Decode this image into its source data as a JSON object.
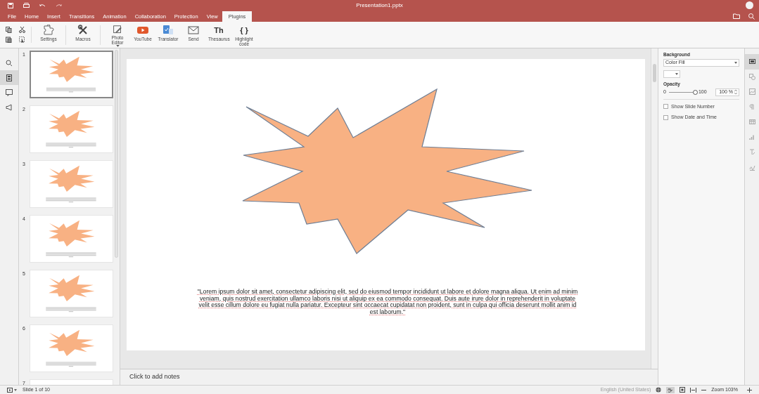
{
  "window": {
    "title": "Presentation1.pptx"
  },
  "menu_tabs": [
    {
      "label": "File",
      "selected": false
    },
    {
      "label": "Home",
      "selected": false
    },
    {
      "label": "Insert",
      "selected": false
    },
    {
      "label": "Transitions",
      "selected": false
    },
    {
      "label": "Animation",
      "selected": false
    },
    {
      "label": "Collaboration",
      "selected": false
    },
    {
      "label": "Protection",
      "selected": false
    },
    {
      "label": "View",
      "selected": false
    },
    {
      "label": "Plugins",
      "selected": true
    }
  ],
  "toolbar": [
    {
      "kind": "settings",
      "label": "Settings"
    },
    {
      "kind": "macros",
      "label": "Macros"
    },
    {
      "kind": "photo",
      "label": "Photo Editor",
      "dropdown": true
    },
    {
      "kind": "youtube",
      "label": "YouTube"
    },
    {
      "kind": "translator",
      "label": "Translator"
    },
    {
      "kind": "send",
      "label": "Send"
    },
    {
      "kind": "thesaurus",
      "label": "Thesaurus",
      "glyph": "Th"
    },
    {
      "kind": "highlight",
      "label": "Highlight code",
      "glyph": "{ }"
    }
  ],
  "left_bar": [
    {
      "kind": "search",
      "selected": false
    },
    {
      "kind": "slides",
      "selected": true
    },
    {
      "kind": "comments",
      "selected": false
    },
    {
      "kind": "speaker",
      "selected": false
    }
  ],
  "thumbnails": [
    {
      "number": "1",
      "selected": true
    },
    {
      "number": "2",
      "selected": false
    },
    {
      "number": "3",
      "selected": false
    },
    {
      "number": "4",
      "selected": false
    },
    {
      "number": "5",
      "selected": false
    },
    {
      "number": "6",
      "selected": false
    },
    {
      "number": "7",
      "selected": false
    }
  ],
  "slide": {
    "text": "\"Lorem ipsum dolor sit amet, consectetur adipiscing elit, sed do eiusmod tempor incididunt ut labore et dolore magna aliqua. Ut enim ad minim veniam, quis nostrud exercitation ullamco laboris nisi ut aliquip ex ea commodo consequat. Duis aute irure dolor in reprehenderit in voluptate velit esse cillum dolore eu fugiat nulla pariatur. Excepteur sint occaecat cupidatat non proident, sunt in culpa qui officia deserunt mollit anim id est laborum.\""
  },
  "notes": {
    "placeholder": "Click to add notes"
  },
  "right_panel": {
    "background_label": "Background",
    "fill_select": "Color Fill",
    "opacity_label": "Opacity",
    "slider_min": "0",
    "slider_max": "100",
    "opacity": {
      "level": 1
    },
    "opacity_value": "100 %",
    "checkboxes": [
      {
        "label": "Show Slide Number",
        "checked": false
      },
      {
        "label": "Show Date and Time",
        "checked": false
      }
    ]
  },
  "right_bar": [
    {
      "kind": "slide",
      "selected": true
    },
    {
      "kind": "shape",
      "selected": false
    },
    {
      "kind": "image",
      "selected": false
    },
    {
      "kind": "paragraph",
      "selected": false
    },
    {
      "kind": "table",
      "selected": false
    },
    {
      "kind": "chart",
      "selected": false
    },
    {
      "kind": "textart",
      "selected": false
    },
    {
      "kind": "signature",
      "selected": false
    }
  ],
  "status_bar": {
    "slide_info": "Slide 1 of 10",
    "language": "English (United States)",
    "zoom": "Zoom 103%"
  }
}
